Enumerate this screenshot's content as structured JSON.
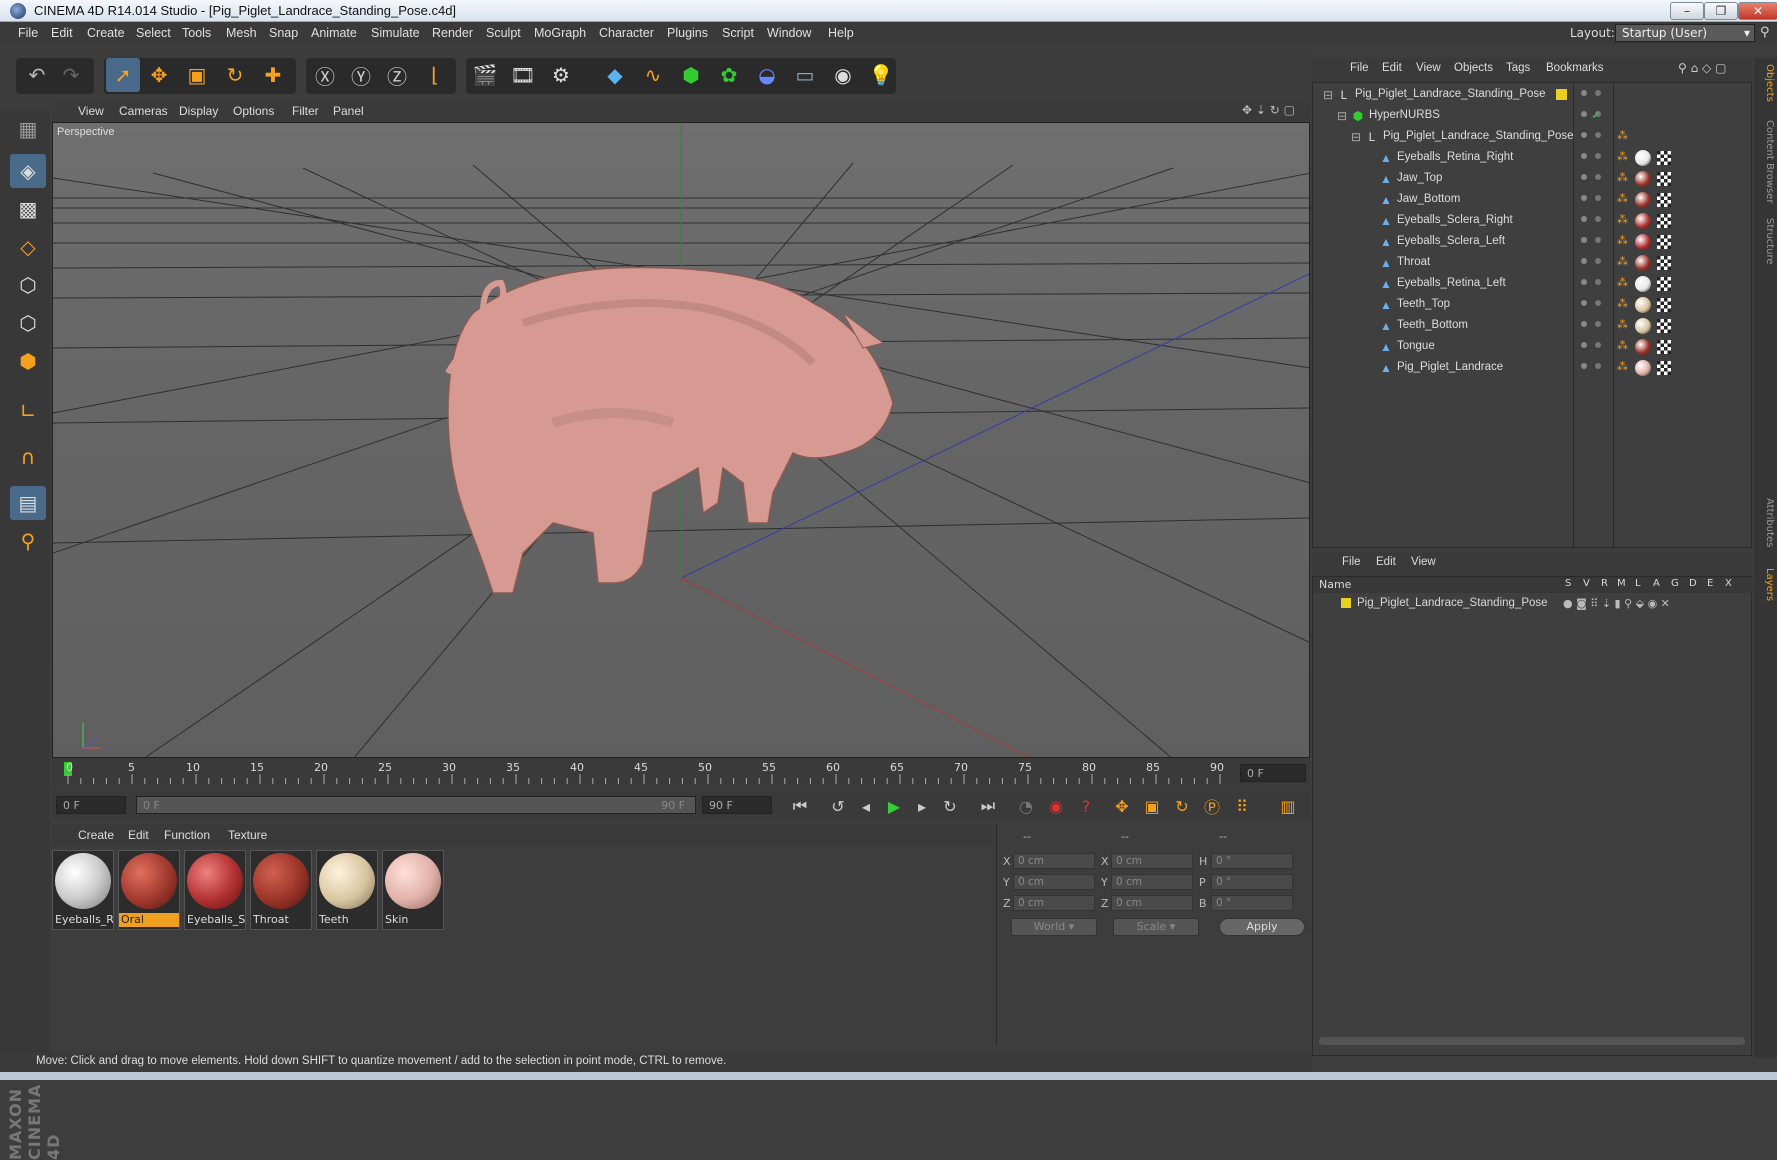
{
  "window": {
    "title": "CINEMA 4D R14.014 Studio - [Pig_Piglet_Landrace_Standing_Pose.c4d]",
    "minimize": "–",
    "maximize": "❐",
    "close": "✕"
  },
  "menubar": {
    "items": [
      "File",
      "Edit",
      "Create",
      "Select",
      "Tools",
      "Mesh",
      "Snap",
      "Animate",
      "Simulate",
      "Render",
      "Sculpt",
      "MoGraph",
      "Character",
      "Plugins",
      "Script",
      "Window",
      "Help"
    ],
    "layout_label": "Layout:",
    "layout_value": "Startup (User)"
  },
  "viewport": {
    "menu": [
      "View",
      "Cameras",
      "Display",
      "Options",
      "Filter",
      "Panel"
    ],
    "label": "Perspective"
  },
  "timeline": {
    "ticks": [
      "0",
      "5",
      "10",
      "15",
      "20",
      "25",
      "30",
      "35",
      "40",
      "45",
      "50",
      "55",
      "60",
      "65",
      "70",
      "75",
      "80",
      "85",
      "90"
    ],
    "current_frame": "0 F",
    "start_field": "0 F",
    "range_start": "0 F",
    "range_end": "90 F",
    "end_field": "90 F"
  },
  "material_manager": {
    "menu": [
      "Create",
      "Edit",
      "Function",
      "Texture"
    ],
    "materials": [
      {
        "name": "Eyeballs_Re",
        "color": "#e8e8e8",
        "selected": false
      },
      {
        "name": "Oral",
        "color": "#a0382c",
        "selected": true
      },
      {
        "name": "Eyeballs_Sc",
        "color": "#b03030",
        "selected": false
      },
      {
        "name": "Throat",
        "color": "#9a3428",
        "selected": false
      },
      {
        "name": "Teeth",
        "color": "#d8c4a0",
        "selected": false
      },
      {
        "name": "Skin",
        "color": "#e0b0a8",
        "selected": false
      }
    ]
  },
  "coordinates": {
    "headers": [
      "--",
      "--",
      "--"
    ],
    "rows": [
      {
        "a": "X",
        "av": "0 cm",
        "b": "X",
        "bv": "0 cm",
        "c": "H",
        "cv": "0 °"
      },
      {
        "a": "Y",
        "av": "0 cm",
        "b": "Y",
        "bv": "0 cm",
        "c": "P",
        "cv": "0 °"
      },
      {
        "a": "Z",
        "av": "0 cm",
        "b": "Z",
        "bv": "0 cm",
        "c": "B",
        "cv": "0 °"
      }
    ],
    "world": "World",
    "scale": "Scale",
    "apply": "Apply"
  },
  "object_manager": {
    "menu": [
      "File",
      "Edit",
      "View",
      "Objects",
      "Tags",
      "Bookmarks"
    ],
    "objects": [
      {
        "name": "Pig_Piglet_Landrace_Standing_Pose",
        "level": 0,
        "icon": "null",
        "mat": "",
        "color": "#e8d020"
      },
      {
        "name": "HyperNURBS",
        "level": 1,
        "icon": "nurbs",
        "mat": "",
        "color": ""
      },
      {
        "name": "Pig_Piglet_Landrace_Standing_Pose",
        "level": 2,
        "icon": "null",
        "mat": "",
        "color": ""
      },
      {
        "name": "Eyeballs_Retina_Right",
        "level": 3,
        "icon": "poly",
        "mat": "#e8e8e8",
        "color": ""
      },
      {
        "name": "Jaw_Top",
        "level": 3,
        "icon": "poly",
        "mat": "#9a3428",
        "color": ""
      },
      {
        "name": "Jaw_Bottom",
        "level": 3,
        "icon": "poly",
        "mat": "#9a3428",
        "color": ""
      },
      {
        "name": "Eyeballs_Sclera_Right",
        "level": 3,
        "icon": "poly",
        "mat": "#b03030",
        "color": ""
      },
      {
        "name": "Eyeballs_Sclera_Left",
        "level": 3,
        "icon": "poly",
        "mat": "#b03030",
        "color": ""
      },
      {
        "name": "Throat",
        "level": 3,
        "icon": "poly",
        "mat": "#9a3428",
        "color": ""
      },
      {
        "name": "Eyeballs_Retina_Left",
        "level": 3,
        "icon": "poly",
        "mat": "#e8e8e8",
        "color": ""
      },
      {
        "name": "Teeth_Top",
        "level": 3,
        "icon": "poly",
        "mat": "#d8c4a0",
        "color": ""
      },
      {
        "name": "Teeth_Bottom",
        "level": 3,
        "icon": "poly",
        "mat": "#d8c4a0",
        "color": ""
      },
      {
        "name": "Tongue",
        "level": 3,
        "icon": "poly",
        "mat": "#9a3428",
        "color": ""
      },
      {
        "name": "Pig_Piglet_Landrace",
        "level": 3,
        "icon": "poly",
        "mat": "#e0b0a8",
        "color": ""
      }
    ]
  },
  "layer_manager": {
    "menu": [
      "File",
      "Edit",
      "View"
    ],
    "columns": [
      "Name",
      "S",
      "V",
      "R",
      "M",
      "L",
      "A",
      "G",
      "D",
      "E",
      "X"
    ],
    "layers": [
      {
        "name": "Pig_Piglet_Landrace_Standing_Pose",
        "color": "#e8d020"
      }
    ]
  },
  "right_tabs": [
    "Objects",
    "Content Browser",
    "Structure",
    "Attributes",
    "Layers"
  ],
  "status": "Move: Click and drag to move elements. Hold down SHIFT to quantize movement / add to the selection in point mode, CTRL to remove.",
  "logo": "MAXON CINEMA 4D"
}
